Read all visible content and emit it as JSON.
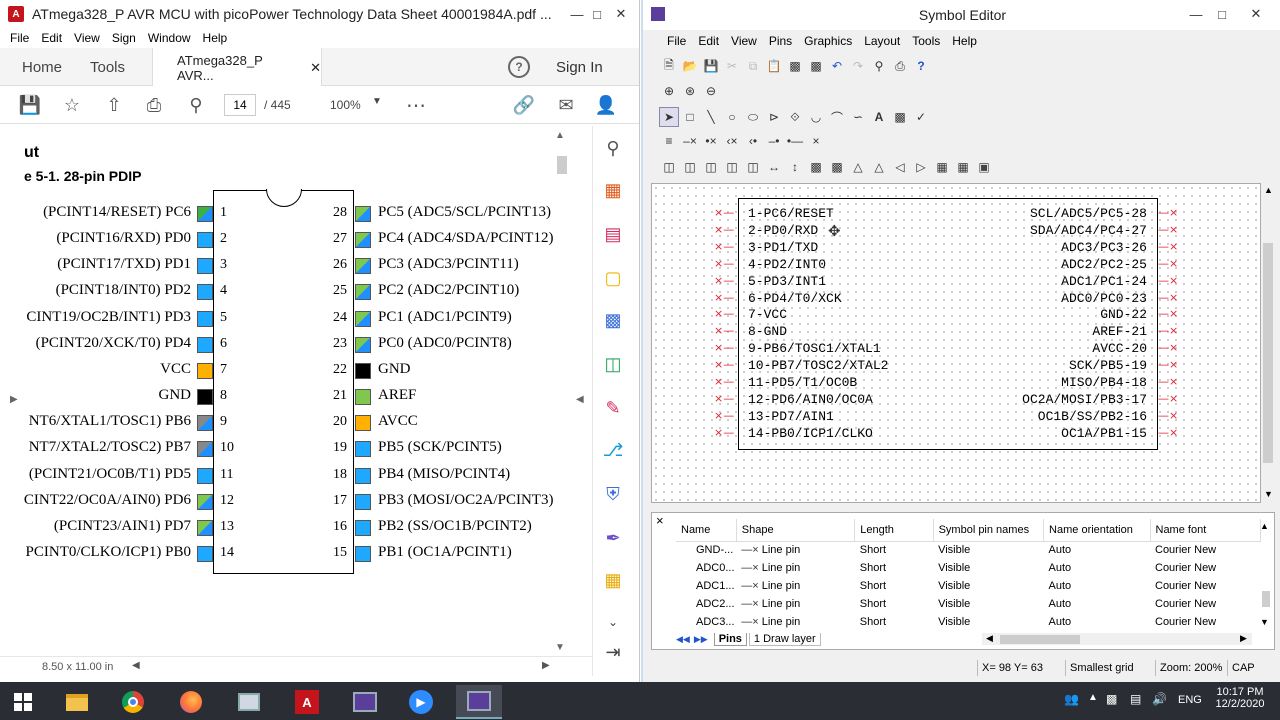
{
  "acrobat": {
    "title": "ATmega328_P AVR MCU with picoPower Technology Data Sheet 40001984A.pdf ...",
    "menu": [
      "File",
      "Edit",
      "View",
      "Sign",
      "Window",
      "Help"
    ],
    "tabs": {
      "home": "Home",
      "tools": "Tools",
      "doc": "ATmega328_P AVR..."
    },
    "sign_in": "Sign In",
    "page": "14",
    "page_total": "/ 445",
    "zoom": "100%",
    "doc_heading": "ut",
    "figure_caption": "e 5-1.  28-pin PDIP",
    "left_pins": [
      {
        "label": "(PCINT14/RESET) PC6",
        "num": "1",
        "color": "#1e90ff",
        "color2": "#3cb043"
      },
      {
        "label": "(PCINT16/RXD) PD0",
        "num": "2",
        "color": "#1ea8ff",
        "color2": ""
      },
      {
        "label": "(PCINT17/TXD) PD1",
        "num": "3",
        "color": "#1ea8ff",
        "color2": ""
      },
      {
        "label": "(PCINT18/INT0) PD2",
        "num": "4",
        "color": "#1ea8ff",
        "color2": ""
      },
      {
        "label": "CINT19/OC2B/INT1) PD3",
        "num": "5",
        "color": "#1ea8ff",
        "color2": ""
      },
      {
        "label": "(PCINT20/XCK/T0) PD4",
        "num": "6",
        "color": "#1ea8ff",
        "color2": ""
      },
      {
        "label": "VCC",
        "num": "7",
        "color": "#ffb000",
        "color2": ""
      },
      {
        "label": "GND",
        "num": "8",
        "color": "#000000",
        "color2": ""
      },
      {
        "label": "NT6/XTAL1/TOSC1) PB6",
        "num": "9",
        "color": "#1e90ff",
        "color2": "#888888"
      },
      {
        "label": "NT7/XTAL2/TOSC2) PB7",
        "num": "10",
        "color": "#1e90ff",
        "color2": "#888888"
      },
      {
        "label": "(PCINT21/OC0B/T1) PD5",
        "num": "11",
        "color": "#1ea8ff",
        "color2": ""
      },
      {
        "label": "CINT22/OC0A/AIN0) PD6",
        "num": "12",
        "color": "#1e90ff",
        "color2": "#7ec850"
      },
      {
        "label": "(PCINT23/AIN1) PD7",
        "num": "13",
        "color": "#1e90ff",
        "color2": "#7ec850"
      },
      {
        "label": "PCINT0/CLKO/ICP1) PB0",
        "num": "14",
        "color": "#1ea8ff",
        "color2": ""
      }
    ],
    "right_pins": [
      {
        "label": "PC5 (ADC5/SCL/PCINT13)",
        "num": "28",
        "color": "#1e90ff",
        "color2": "#7ec850"
      },
      {
        "label": "PC4 (ADC4/SDA/PCINT12)",
        "num": "27",
        "color": "#1e90ff",
        "color2": "#7ec850"
      },
      {
        "label": "PC3 (ADC3/PCINT11)",
        "num": "26",
        "color": "#1e90ff",
        "color2": "#7ec850"
      },
      {
        "label": "PC2 (ADC2/PCINT10)",
        "num": "25",
        "color": "#1e90ff",
        "color2": "#7ec850"
      },
      {
        "label": "PC1 (ADC1/PCINT9)",
        "num": "24",
        "color": "#1e90ff",
        "color2": "#7ec850"
      },
      {
        "label": "PC0 (ADC0/PCINT8)",
        "num": "23",
        "color": "#1e90ff",
        "color2": "#7ec850"
      },
      {
        "label": "GND",
        "num": "22",
        "color": "#000000",
        "color2": ""
      },
      {
        "label": "AREF",
        "num": "21",
        "color": "#7ec850",
        "color2": ""
      },
      {
        "label": "AVCC",
        "num": "20",
        "color": "#ffb000",
        "color2": ""
      },
      {
        "label": "PB5 (SCK/PCINT5)",
        "num": "19",
        "color": "#1ea8ff",
        "color2": ""
      },
      {
        "label": "PB4 (MISO/PCINT4)",
        "num": "18",
        "color": "#1ea8ff",
        "color2": ""
      },
      {
        "label": "PB3 (MOSI/OC2A/PCINT3)",
        "num": "17",
        "color": "#1ea8ff",
        "color2": ""
      },
      {
        "label": "PB2 (SS/OC1B/PCINT2)",
        "num": "16",
        "color": "#1ea8ff",
        "color2": ""
      },
      {
        "label": "PB1 (OC1A/PCINT1)",
        "num": "15",
        "color": "#1ea8ff",
        "color2": ""
      }
    ],
    "page_size": "8.50 x 11.00 in"
  },
  "symbol_editor": {
    "title": "Symbol Editor",
    "menu": [
      "File",
      "Edit",
      "View",
      "Pins",
      "Graphics",
      "Layout",
      "Tools",
      "Help"
    ],
    "left_pins": [
      "1-PC6/RESET",
      "2-PD0/RXD",
      "3-PD1/TXD",
      "4-PD2/INT0",
      "5-PD3/INT1",
      "6-PD4/T0/XCK",
      "7-VCC",
      "8-GND",
      "9-PB6/TOSC1/XTAL1",
      "10-PB7/TOSC2/XTAL2",
      "11-PD5/T1/OC0B",
      "12-PD6/AIN0/OC0A",
      "13-PD7/AIN1",
      "14-PB0/ICP1/CLKO"
    ],
    "right_pins": [
      "SCL/ADC5/PC5-28",
      "SDA/ADC4/PC4-27",
      "ADC3/PC3-26",
      "ADC2/PC2-25",
      "ADC1/PC1-24",
      "ADC0/PC0-23",
      "GND-22",
      "AREF-21",
      "AVCC-20",
      "SCK/PB5-19",
      "MISO/PB4-18",
      "OC2A/MOSI/PB3-17",
      "OC1B/SS/PB2-16",
      "OC1A/PB1-15"
    ],
    "table_headers": [
      "Name",
      "Shape",
      "Length",
      "Symbol pin names",
      "Name orientation",
      "Name font"
    ],
    "table_rows": [
      [
        "GND-...",
        "Line pin",
        "Short",
        "Visible",
        "Auto",
        "Courier New"
      ],
      [
        "ADC0...",
        "Line pin",
        "Short",
        "Visible",
        "Auto",
        "Courier New"
      ],
      [
        "ADC1...",
        "Line pin",
        "Short",
        "Visible",
        "Auto",
        "Courier New"
      ],
      [
        "ADC2...",
        "Line pin",
        "Short",
        "Visible",
        "Auto",
        "Courier New"
      ],
      [
        "ADC3...",
        "Line pin",
        "Short",
        "Visible",
        "Auto",
        "Courier New"
      ]
    ],
    "tabs": [
      "Pins",
      "1 Draw layer"
    ],
    "status": {
      "coords": "X= 98 Y= 63",
      "grid": "Smallest grid",
      "zoom": "Zoom: 200%",
      "caps": "CAP"
    }
  },
  "taskbar": {
    "time": "10:17 PM",
    "date": "12/2/2020",
    "lang": "ENG"
  }
}
